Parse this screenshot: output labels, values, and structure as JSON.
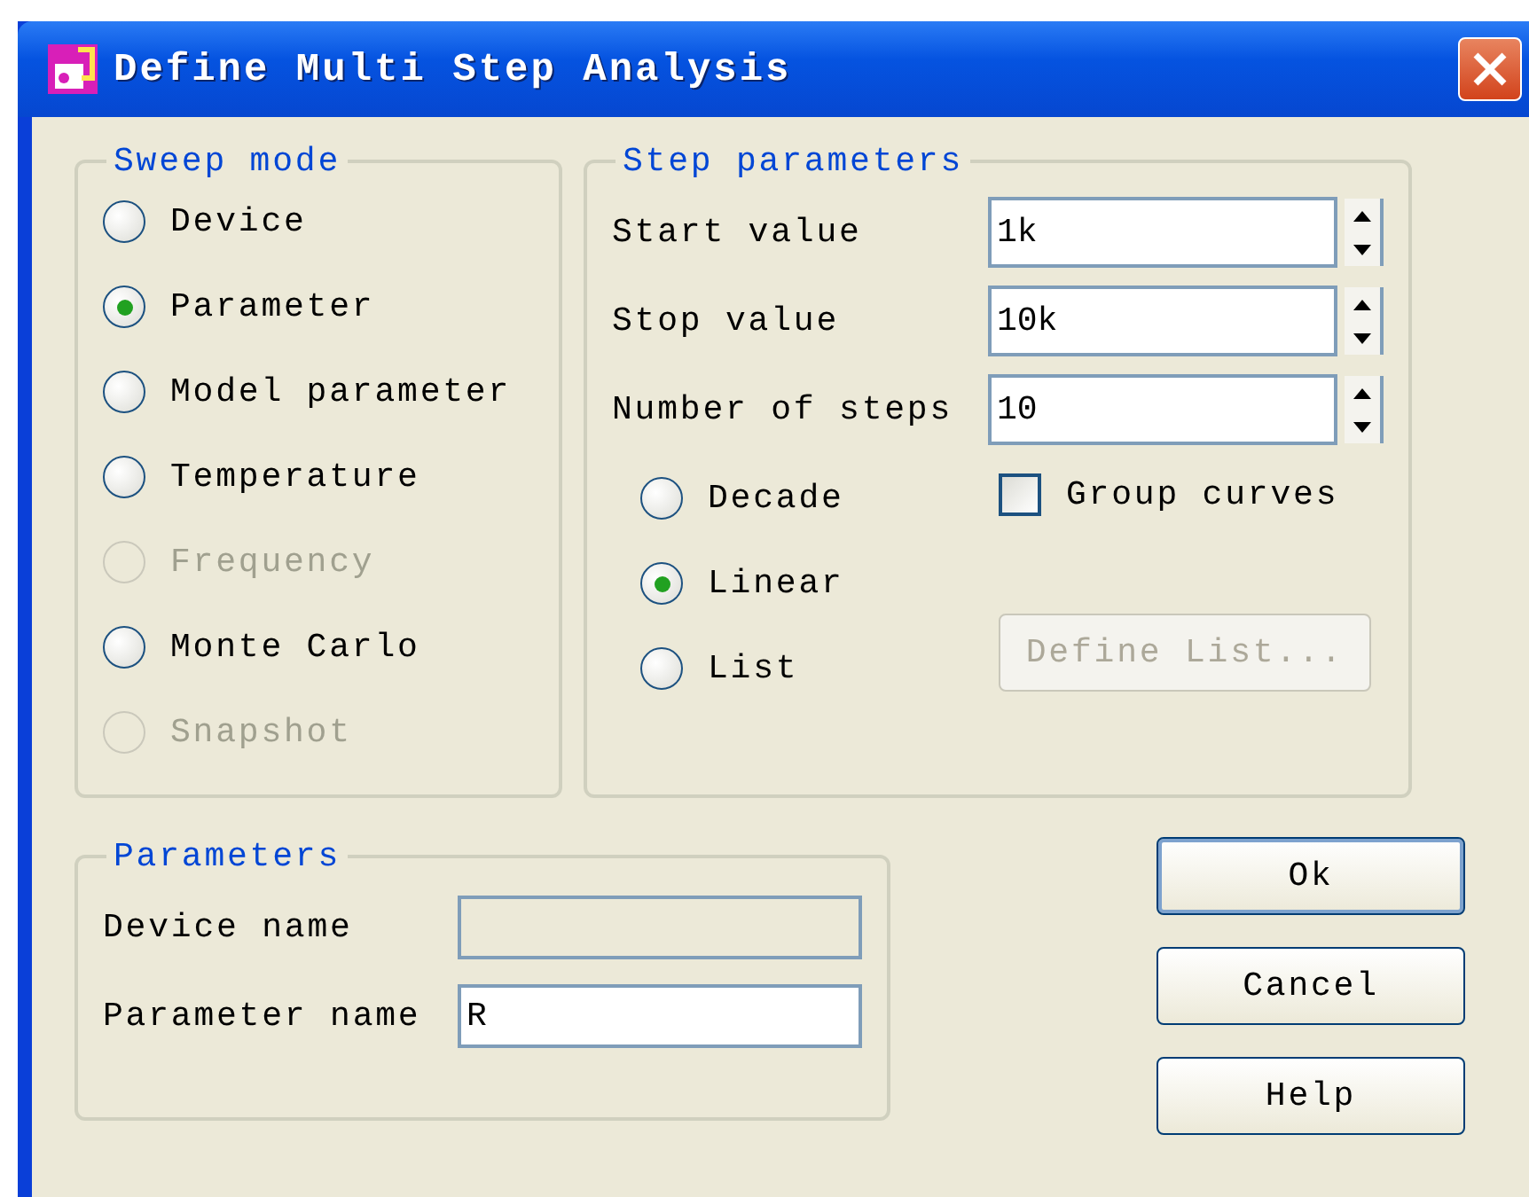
{
  "window": {
    "title": "Define Multi Step Analysis"
  },
  "sweep_mode": {
    "title": "Sweep mode",
    "options": [
      {
        "label": "Device",
        "selected": false,
        "disabled": false
      },
      {
        "label": "Parameter",
        "selected": true,
        "disabled": false
      },
      {
        "label": "Model parameter",
        "selected": false,
        "disabled": false
      },
      {
        "label": "Temperature",
        "selected": false,
        "disabled": false
      },
      {
        "label": "Frequency",
        "selected": false,
        "disabled": true
      },
      {
        "label": "Monte Carlo",
        "selected": false,
        "disabled": false
      },
      {
        "label": "Snapshot",
        "selected": false,
        "disabled": true
      }
    ]
  },
  "step_parameters": {
    "title": "Step parameters",
    "fields": [
      {
        "label": "Start value",
        "value": "1k"
      },
      {
        "label": "Stop value",
        "value": "10k"
      },
      {
        "label": "Number of steps",
        "value": "10"
      }
    ],
    "scales": [
      {
        "label": "Decade",
        "selected": false
      },
      {
        "label": "Linear",
        "selected": true
      },
      {
        "label": "List",
        "selected": false
      }
    ],
    "group_curves": {
      "label": "Group curves",
      "checked": false
    },
    "define_list_button": {
      "label": "Define List...",
      "disabled": true
    }
  },
  "parameters": {
    "title": "Parameters",
    "fields": [
      {
        "label": "Device name",
        "disabled": true
      },
      {
        "label": "Parameter name",
        "value": "R",
        "disabled": false
      }
    ]
  },
  "buttons": [
    {
      "label": "Ok",
      "default": true
    },
    {
      "label": "Cancel",
      "default": false
    },
    {
      "label": "Help",
      "default": false
    }
  ]
}
